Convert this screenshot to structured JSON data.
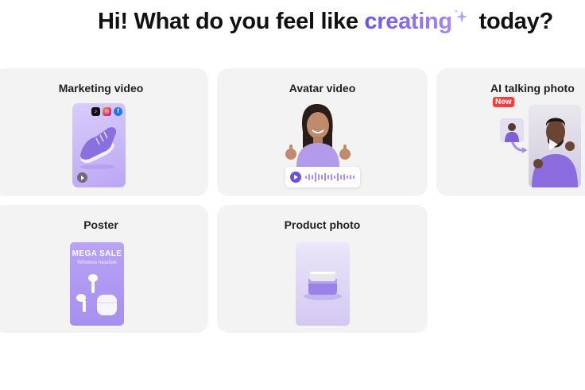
{
  "header": {
    "title_prefix": "Hi! What do you feel like",
    "title_accent": "creating",
    "title_suffix": "today?"
  },
  "cards": [
    {
      "title": "Marketing video"
    },
    {
      "title": "Avatar video"
    },
    {
      "title": "AI talking photo",
      "badge": "New"
    },
    {
      "title": "Poster",
      "poster_heading": "MEGA SALE",
      "poster_sub": "Wireless headset"
    },
    {
      "title": "Product photo"
    }
  ],
  "icons": {
    "tiktok": "tiktok-icon",
    "instagram": "instagram-icon",
    "facebook": "facebook-icon"
  },
  "colors": {
    "accent_start": "#6a52e6",
    "accent_end": "#a58af2",
    "card_bg": "#f3f3f4",
    "badge_red": "#ff3b3b",
    "lavender": "#b8a3f6"
  }
}
